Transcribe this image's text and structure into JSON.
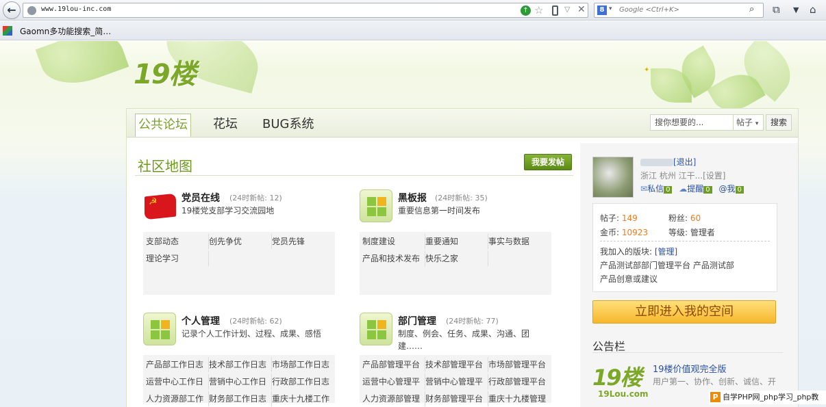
{
  "browser": {
    "url": "www.19lou-inc.com",
    "search_placeholder": "Google <Ctrl+K>",
    "bookmark_label": "Gaomn多功能搜索_简…"
  },
  "site": {
    "logo": "19楼",
    "tabs": [
      {
        "label": "公共论坛",
        "active": true
      },
      {
        "label": "花坛",
        "active": false
      },
      {
        "label": "BUG系统",
        "active": false
      }
    ],
    "search_placeholder": "搜你想要的...",
    "search_type": "帖子",
    "search_button": "搜索"
  },
  "main": {
    "title": "社区地图",
    "post_button": "我要发帖",
    "forums": [
      {
        "name": "党员在线",
        "new_posts": "(24时新帖: 12)",
        "desc": "19楼党支部学习交流园地",
        "links": [
          "支部动态",
          "创先争优",
          "党员先锋",
          "理论学习"
        ]
      },
      {
        "name": "黑板报",
        "new_posts": "(24时新帖: 35)",
        "desc": "重要信息第一时间发布",
        "links": [
          "制度建设",
          "重要通知",
          "事实与数据",
          "产品和技术发布",
          "快乐之家"
        ]
      },
      {
        "name": "个人管理",
        "new_posts": "(24时新帖: 62)",
        "desc": "记录个人工作计划、过程、成果、感悟",
        "links": [
          "产品部工作日志",
          "技术部工作日志",
          "市场部工作日志",
          "运营中心工作日",
          "营销中心工作日",
          "行政部工作日志",
          "人力资源部工作",
          "财务部工作日志",
          "重庆十九楼工作"
        ]
      },
      {
        "name": "部门管理",
        "new_posts": "(24时新帖: 77)",
        "desc": "制度、例会、任务、成果、沟通、团建……",
        "links": [
          "产品部管理平台",
          "技术部管理平台",
          "市场部管理平台",
          "运营中心管理平",
          "营销中心管理平",
          "行政部管理平台",
          "人力资源部管理",
          "财务部管理平台",
          "重庆十九楼管理"
        ]
      }
    ]
  },
  "sidebar": {
    "logout": "[退出]",
    "location": "浙江  杭州  江干...",
    "settings": "[设置]",
    "messages": {
      "label": "私信",
      "count": "0"
    },
    "reminders": {
      "label": "提醒",
      "count": "0"
    },
    "mentions": {
      "label": "@我",
      "count": "0"
    },
    "stats": {
      "posts_label": "帖子:",
      "posts": "149",
      "fans_label": "粉丝:",
      "fans": "60",
      "coins_label": "金币:",
      "coins": "10923",
      "level_label": "等级:",
      "level": "管理者"
    },
    "joined_label": "我加入的版块:",
    "manage_link": "[管理]",
    "joined_line1": "产品测试部部门管理平台  产品测试部",
    "joined_line2": "产品创意或建议",
    "space_button": "立即进入我的空间",
    "notice_title": "公告栏",
    "notice_logo_text": "19楼",
    "notice_logo_domain": "19Lou.com",
    "notice_head": "19楼价值观完全版",
    "notice_text": "用户第一、协作、创新、诚信、开"
  },
  "watermark": "自学PHP网_php学习_php教"
}
